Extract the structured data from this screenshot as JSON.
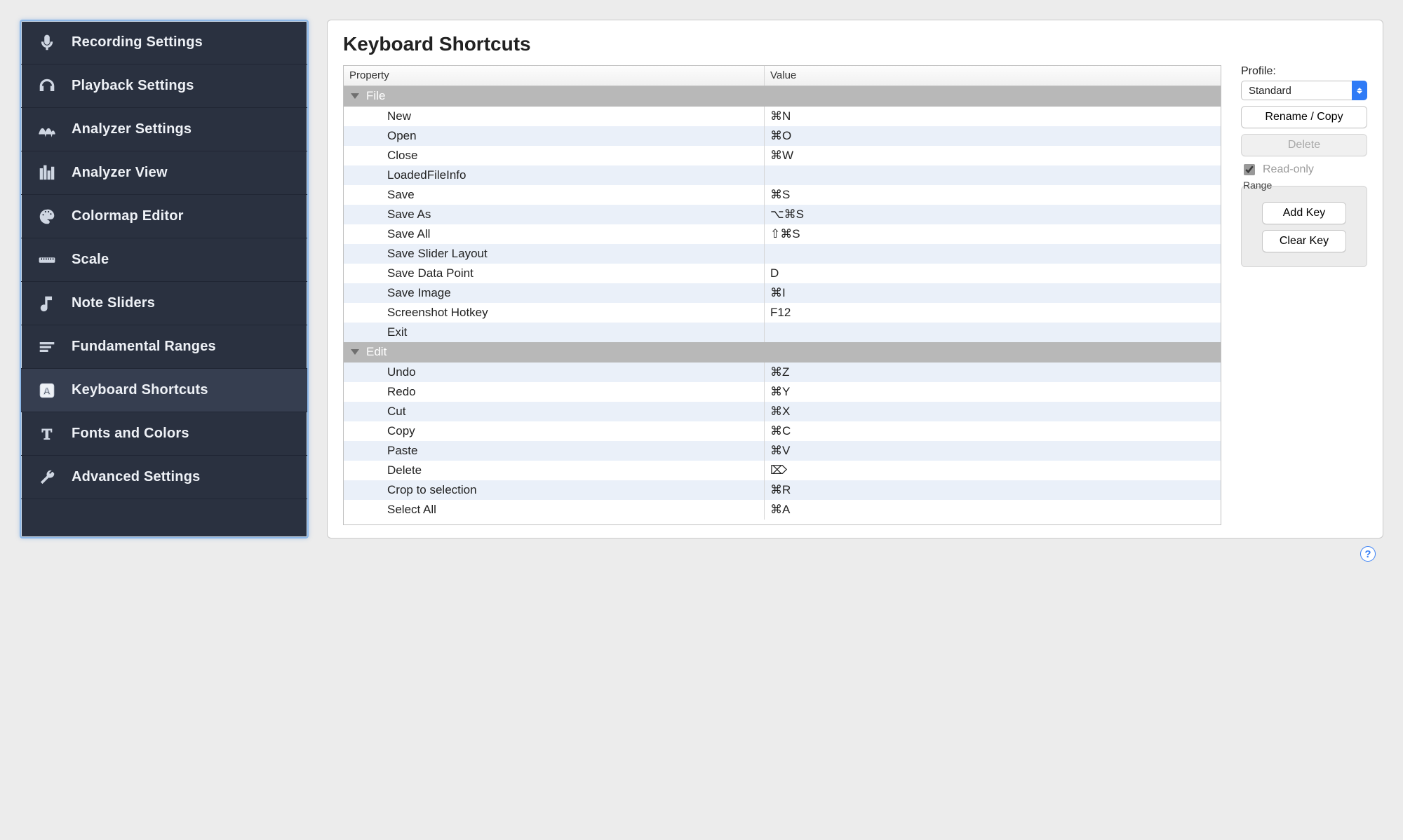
{
  "sidebar": {
    "items": [
      {
        "label": "Recording Settings",
        "icon": "microphone-icon"
      },
      {
        "label": "Playback Settings",
        "icon": "headphones-icon"
      },
      {
        "label": "Analyzer Settings",
        "icon": "waveform-icon"
      },
      {
        "label": "Analyzer View",
        "icon": "bars-icon"
      },
      {
        "label": "Colormap Editor",
        "icon": "palette-icon"
      },
      {
        "label": "Scale",
        "icon": "ruler-icon"
      },
      {
        "label": "Note Sliders",
        "icon": "note-icon"
      },
      {
        "label": "Fundamental Ranges",
        "icon": "lines-icon"
      },
      {
        "label": "Keyboard Shortcuts",
        "icon": "key-a-icon"
      },
      {
        "label": "Fonts and Colors",
        "icon": "text-t-icon"
      },
      {
        "label": "Advanced Settings",
        "icon": "wrench-icon"
      }
    ],
    "selectedIndex": 8
  },
  "page": {
    "title": "Keyboard Shortcuts"
  },
  "table": {
    "columns": {
      "property": "Property",
      "value": "Value"
    },
    "sections": [
      {
        "name": "File",
        "rows": [
          {
            "property": "New",
            "value": "⌘N"
          },
          {
            "property": "Open",
            "value": "⌘O"
          },
          {
            "property": "Close",
            "value": "⌘W"
          },
          {
            "property": "LoadedFileInfo",
            "value": ""
          },
          {
            "property": "Save",
            "value": "⌘S"
          },
          {
            "property": "Save As",
            "value": "⌥⌘S"
          },
          {
            "property": "Save All",
            "value": "⇧⌘S"
          },
          {
            "property": "Save Slider Layout",
            "value": ""
          },
          {
            "property": "Save Data Point",
            "value": "D"
          },
          {
            "property": "Save Image",
            "value": "⌘I"
          },
          {
            "property": "Screenshot Hotkey",
            "value": "F12"
          },
          {
            "property": "Exit",
            "value": ""
          }
        ]
      },
      {
        "name": "Edit",
        "rows": [
          {
            "property": "Undo",
            "value": "⌘Z"
          },
          {
            "property": "Redo",
            "value": "⌘Y"
          },
          {
            "property": "Cut",
            "value": "⌘X"
          },
          {
            "property": "Copy",
            "value": "⌘C"
          },
          {
            "property": "Paste",
            "value": "⌘V"
          },
          {
            "property": "Delete",
            "value": "⌦"
          },
          {
            "property": "Crop to selection",
            "value": "⌘R"
          },
          {
            "property": "Select All",
            "value": "⌘A"
          }
        ]
      }
    ]
  },
  "controls": {
    "profileLabel": "Profile:",
    "profileValue": "Standard",
    "renameCopy": "Rename / Copy",
    "delete": "Delete",
    "readOnly": "Read-only",
    "readOnlyChecked": true,
    "rangeTitle": "Range",
    "addKey": "Add Key",
    "clearKey": "Clear Key"
  }
}
